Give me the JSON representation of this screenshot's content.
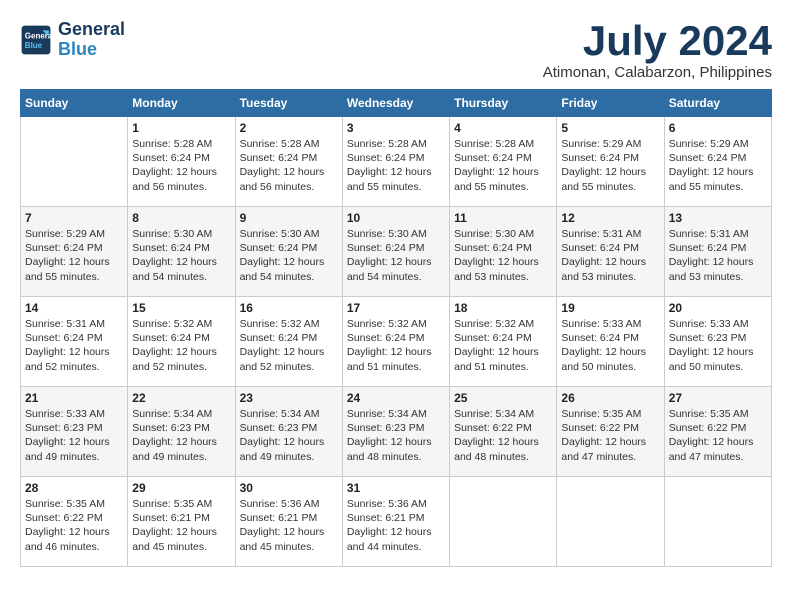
{
  "logo": {
    "line1": "General",
    "line2": "Blue"
  },
  "title": "July 2024",
  "location": "Atimonan, Calabarzon, Philippines",
  "weekdays": [
    "Sunday",
    "Monday",
    "Tuesday",
    "Wednesday",
    "Thursday",
    "Friday",
    "Saturday"
  ],
  "weeks": [
    [
      {
        "day": "",
        "info": ""
      },
      {
        "day": "1",
        "info": "Sunrise: 5:28 AM\nSunset: 6:24 PM\nDaylight: 12 hours\nand 56 minutes."
      },
      {
        "day": "2",
        "info": "Sunrise: 5:28 AM\nSunset: 6:24 PM\nDaylight: 12 hours\nand 56 minutes."
      },
      {
        "day": "3",
        "info": "Sunrise: 5:28 AM\nSunset: 6:24 PM\nDaylight: 12 hours\nand 55 minutes."
      },
      {
        "day": "4",
        "info": "Sunrise: 5:28 AM\nSunset: 6:24 PM\nDaylight: 12 hours\nand 55 minutes."
      },
      {
        "day": "5",
        "info": "Sunrise: 5:29 AM\nSunset: 6:24 PM\nDaylight: 12 hours\nand 55 minutes."
      },
      {
        "day": "6",
        "info": "Sunrise: 5:29 AM\nSunset: 6:24 PM\nDaylight: 12 hours\nand 55 minutes."
      }
    ],
    [
      {
        "day": "7",
        "info": "Sunrise: 5:29 AM\nSunset: 6:24 PM\nDaylight: 12 hours\nand 55 minutes."
      },
      {
        "day": "8",
        "info": "Sunrise: 5:30 AM\nSunset: 6:24 PM\nDaylight: 12 hours\nand 54 minutes."
      },
      {
        "day": "9",
        "info": "Sunrise: 5:30 AM\nSunset: 6:24 PM\nDaylight: 12 hours\nand 54 minutes."
      },
      {
        "day": "10",
        "info": "Sunrise: 5:30 AM\nSunset: 6:24 PM\nDaylight: 12 hours\nand 54 minutes."
      },
      {
        "day": "11",
        "info": "Sunrise: 5:30 AM\nSunset: 6:24 PM\nDaylight: 12 hours\nand 53 minutes."
      },
      {
        "day": "12",
        "info": "Sunrise: 5:31 AM\nSunset: 6:24 PM\nDaylight: 12 hours\nand 53 minutes."
      },
      {
        "day": "13",
        "info": "Sunrise: 5:31 AM\nSunset: 6:24 PM\nDaylight: 12 hours\nand 53 minutes."
      }
    ],
    [
      {
        "day": "14",
        "info": "Sunrise: 5:31 AM\nSunset: 6:24 PM\nDaylight: 12 hours\nand 52 minutes."
      },
      {
        "day": "15",
        "info": "Sunrise: 5:32 AM\nSunset: 6:24 PM\nDaylight: 12 hours\nand 52 minutes."
      },
      {
        "day": "16",
        "info": "Sunrise: 5:32 AM\nSunset: 6:24 PM\nDaylight: 12 hours\nand 52 minutes."
      },
      {
        "day": "17",
        "info": "Sunrise: 5:32 AM\nSunset: 6:24 PM\nDaylight: 12 hours\nand 51 minutes."
      },
      {
        "day": "18",
        "info": "Sunrise: 5:32 AM\nSunset: 6:24 PM\nDaylight: 12 hours\nand 51 minutes."
      },
      {
        "day": "19",
        "info": "Sunrise: 5:33 AM\nSunset: 6:24 PM\nDaylight: 12 hours\nand 50 minutes."
      },
      {
        "day": "20",
        "info": "Sunrise: 5:33 AM\nSunset: 6:23 PM\nDaylight: 12 hours\nand 50 minutes."
      }
    ],
    [
      {
        "day": "21",
        "info": "Sunrise: 5:33 AM\nSunset: 6:23 PM\nDaylight: 12 hours\nand 49 minutes."
      },
      {
        "day": "22",
        "info": "Sunrise: 5:34 AM\nSunset: 6:23 PM\nDaylight: 12 hours\nand 49 minutes."
      },
      {
        "day": "23",
        "info": "Sunrise: 5:34 AM\nSunset: 6:23 PM\nDaylight: 12 hours\nand 49 minutes."
      },
      {
        "day": "24",
        "info": "Sunrise: 5:34 AM\nSunset: 6:23 PM\nDaylight: 12 hours\nand 48 minutes."
      },
      {
        "day": "25",
        "info": "Sunrise: 5:34 AM\nSunset: 6:22 PM\nDaylight: 12 hours\nand 48 minutes."
      },
      {
        "day": "26",
        "info": "Sunrise: 5:35 AM\nSunset: 6:22 PM\nDaylight: 12 hours\nand 47 minutes."
      },
      {
        "day": "27",
        "info": "Sunrise: 5:35 AM\nSunset: 6:22 PM\nDaylight: 12 hours\nand 47 minutes."
      }
    ],
    [
      {
        "day": "28",
        "info": "Sunrise: 5:35 AM\nSunset: 6:22 PM\nDaylight: 12 hours\nand 46 minutes."
      },
      {
        "day": "29",
        "info": "Sunrise: 5:35 AM\nSunset: 6:21 PM\nDaylight: 12 hours\nand 45 minutes."
      },
      {
        "day": "30",
        "info": "Sunrise: 5:36 AM\nSunset: 6:21 PM\nDaylight: 12 hours\nand 45 minutes."
      },
      {
        "day": "31",
        "info": "Sunrise: 5:36 AM\nSunset: 6:21 PM\nDaylight: 12 hours\nand 44 minutes."
      },
      {
        "day": "",
        "info": ""
      },
      {
        "day": "",
        "info": ""
      },
      {
        "day": "",
        "info": ""
      }
    ]
  ]
}
